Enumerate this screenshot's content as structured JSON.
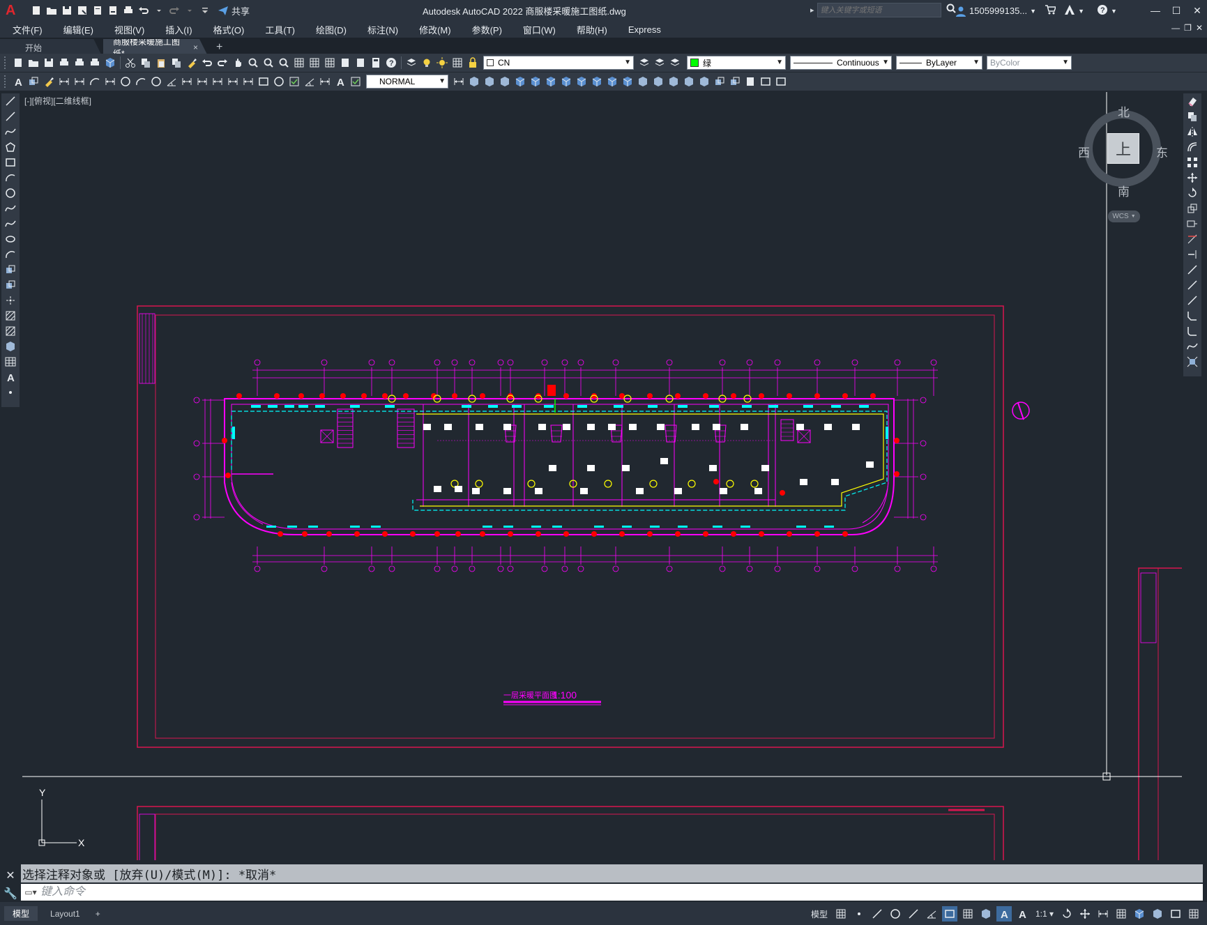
{
  "app": {
    "logo": "A",
    "title": "Autodesk AutoCAD 2022    商服楼采暖施工图纸.dwg",
    "share_label": "共享",
    "search_placeholder": "键入关键字或短语",
    "user_label": "1505999135..."
  },
  "menu": {
    "items": [
      "文件(F)",
      "编辑(E)",
      "视图(V)",
      "插入(I)",
      "格式(O)",
      "工具(T)",
      "绘图(D)",
      "标注(N)",
      "修改(M)",
      "参数(P)",
      "窗口(W)",
      "帮助(H)",
      "Express"
    ]
  },
  "tabs": {
    "start": "开始",
    "active": "商服楼采暖施工图纸*",
    "close": "×",
    "add": "+"
  },
  "toolbar1": {
    "layer_value": "CN",
    "color_value": "绿",
    "linetype_value": "Continuous",
    "lineweight_value": "ByLayer",
    "plotstyle_value": "ByColor"
  },
  "toolbar2": {
    "textstyle_value": "NORMAL"
  },
  "viewport": {
    "label": "[-][俯视][二维线框]",
    "drawing_title": "一层采暖平面图",
    "drawing_scale": "1:100",
    "axis_y": "Y",
    "axis_x": "X"
  },
  "viewcube": {
    "north": "北",
    "south": "南",
    "east": "东",
    "west": "西",
    "face": "上",
    "wcs": "WCS"
  },
  "commandline": {
    "history": "选择注释对象或 [放弃(U)/模式(M)]: *取消*",
    "input_placeholder": "键入命令"
  },
  "statusbar": {
    "model_tab": "模型",
    "layout_tab": "Layout1",
    "add": "+",
    "model_label": "模型",
    "scale": "1:1"
  },
  "colors": {
    "magenta": "#ff00ff",
    "red": "#ff0000",
    "cyan": "#00ffff",
    "yellow": "#ffff00",
    "green": "#00ff00",
    "frame": "#d8164f"
  }
}
